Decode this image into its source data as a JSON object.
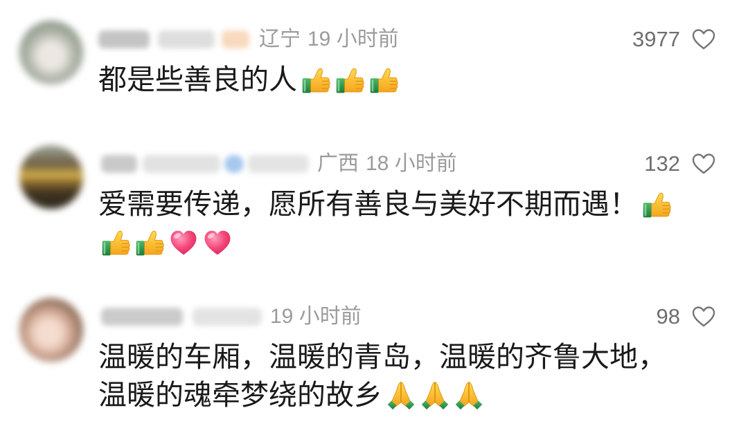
{
  "theme": {
    "background": "#ffffff",
    "text": "#1a1a1a",
    "meta_text": "#9b9b9b",
    "count_text": "#6e6e6e",
    "icon": "#757575"
  },
  "comments": [
    {
      "location": "辽宁",
      "time": "19 小时前",
      "likes": "3977",
      "like_icon": "heart-outline",
      "lines": [
        {
          "text": "都是些善良的人",
          "emojis": [
            "thumbs-up",
            "thumbs-up",
            "thumbs-up"
          ]
        }
      ]
    },
    {
      "location": "广西",
      "time": "18 小时前",
      "likes": "132",
      "like_icon": "heart-outline",
      "lines": [
        {
          "text": "爱需要传递，愿所有善良与美好不期而遇！",
          "emojis": [
            "thumbs-up"
          ]
        },
        {
          "emojis": [
            "thumbs-up",
            "thumbs-up",
            "heart",
            "heart"
          ]
        }
      ]
    },
    {
      "time": "19 小时前",
      "likes": "98",
      "like_icon": "heart-outline",
      "lines": [
        {
          "text": "温暖的车厢，温暖的青岛，温暖的齐鲁大地，",
          "emojis": []
        },
        {
          "text": "温暖的魂牵梦绕的故乡",
          "emojis": [
            "folded-hands",
            "folded-hands",
            "folded-hands"
          ]
        }
      ]
    }
  ]
}
